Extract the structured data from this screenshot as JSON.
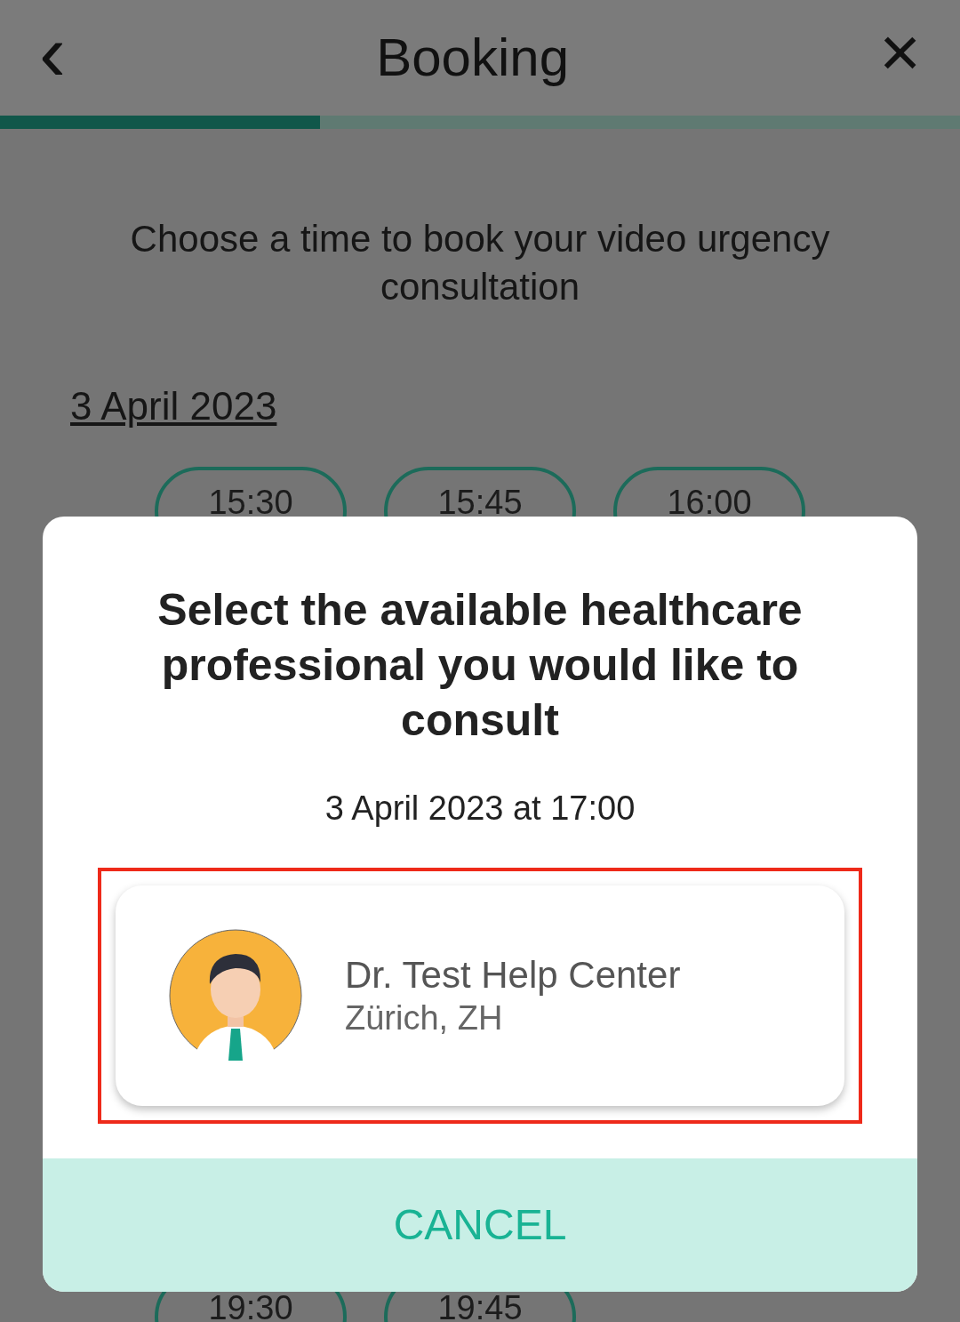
{
  "header": {
    "title": "Booking",
    "back": "‹",
    "close": "×"
  },
  "progress": {
    "level": 0.333
  },
  "instruction": "Choose a time to book your video urgency consultation",
  "date_link": "3 April 2023",
  "time_slots_top": [
    {
      "label": "15:30",
      "selected": false
    },
    {
      "label": "15:45",
      "selected": false
    },
    {
      "label": "16:00",
      "selected": false
    }
  ],
  "time_slots_bottom": [
    {
      "label": "19:30",
      "selected": false
    },
    {
      "label": "19:45",
      "selected": false
    }
  ],
  "dialog": {
    "title": "Select the available healthcare professional you would like to consult",
    "when": "3 April 2023 at 17:00",
    "professionals": [
      {
        "name": "Dr. Test Help Center",
        "location": "Zürich, ZH",
        "highlighted": true
      }
    ],
    "cancel": "CANCEL"
  }
}
